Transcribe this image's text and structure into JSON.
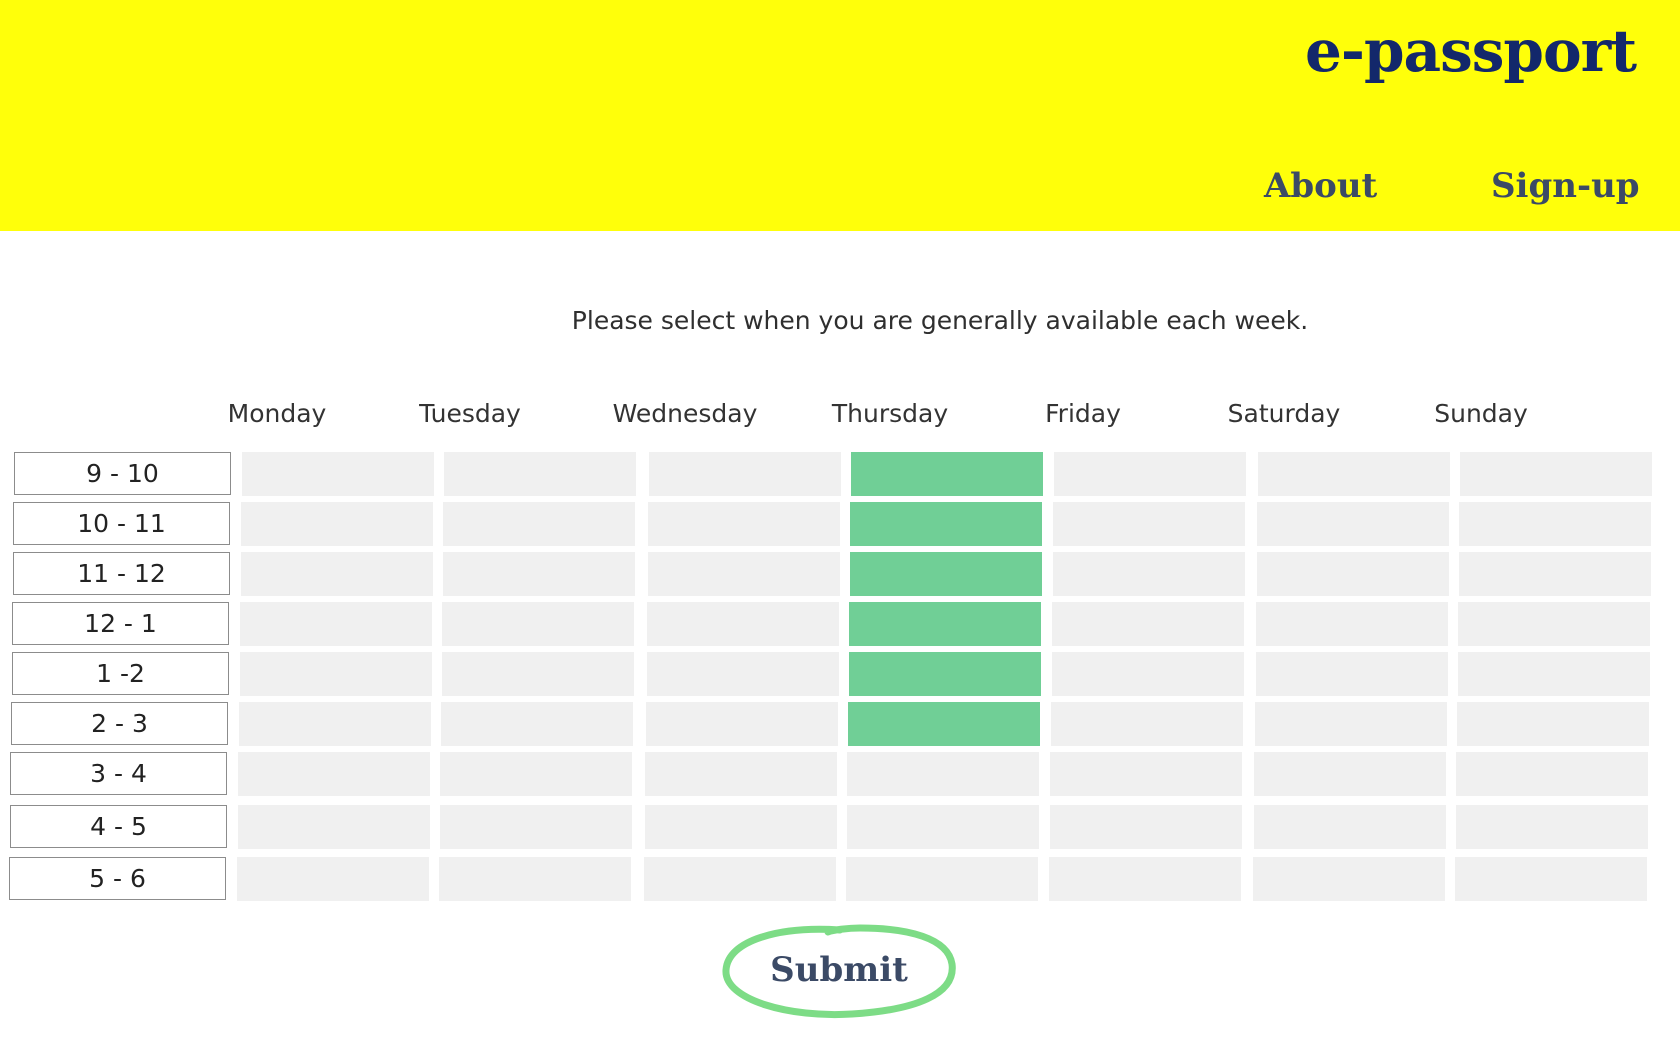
{
  "header": {
    "brand": "e-passport",
    "nav": [
      {
        "label": "About"
      },
      {
        "label": "Sign-up"
      }
    ]
  },
  "prompt": "Please select when you are generally available each week.",
  "schedule": {
    "days": [
      "Monday",
      "Tuesday",
      "Wednesday",
      "Thursday",
      "Friday",
      "Saturday",
      "Sunday"
    ],
    "times": [
      "9 - 10",
      "10 - 11",
      "11 - 12",
      "12 - 1",
      "1 -2",
      "2 - 3",
      "3 - 4",
      "4 - 5",
      "5 - 6"
    ],
    "selected": [
      {
        "day": "Thursday",
        "time": "9 - 10"
      },
      {
        "day": "Thursday",
        "time": "10 - 11"
      },
      {
        "day": "Thursday",
        "time": "11 - 12"
      },
      {
        "day": "Thursday",
        "time": "12 - 1"
      },
      {
        "day": "Thursday",
        "time": "1 -2"
      },
      {
        "day": "Thursday",
        "time": "2 - 3"
      }
    ]
  },
  "submit": {
    "label": "Submit"
  },
  "colors": {
    "header_bg": "#ffff0a",
    "brand": "#13286b",
    "selected_slot": "#70cf96",
    "empty_slot": "#f0f0f0",
    "submit_circle": "#7ddc86"
  }
}
